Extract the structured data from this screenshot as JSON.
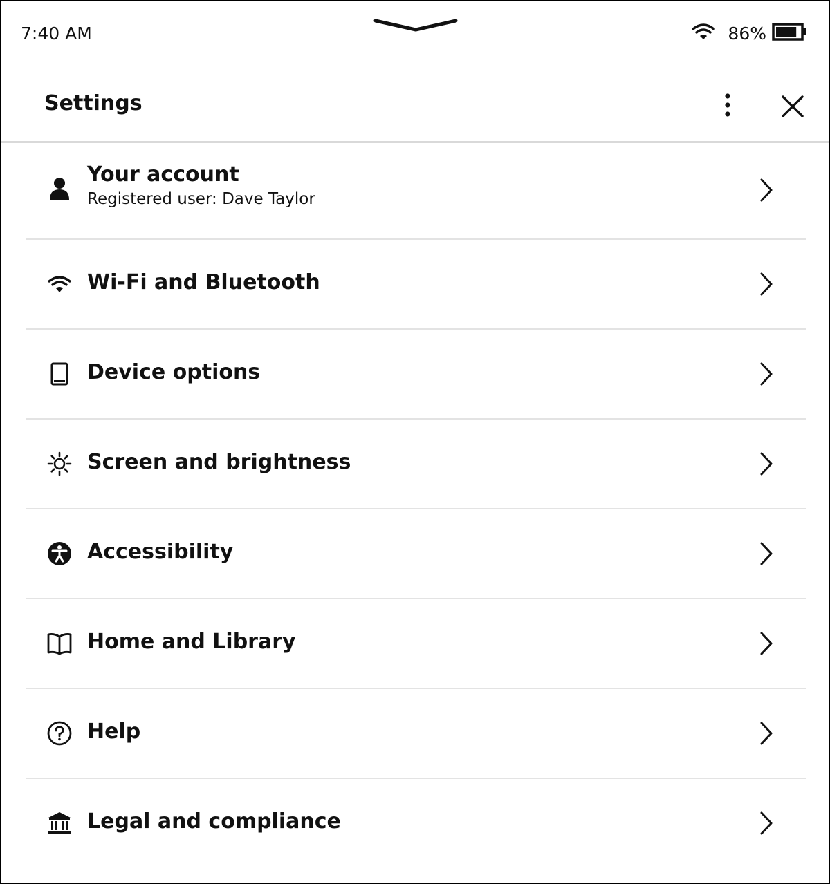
{
  "status_bar": {
    "time": "7:40 AM",
    "battery_percent": "86%",
    "battery_level": 0.86,
    "icons": [
      "pulldown-chevron-icon",
      "wifi-icon",
      "battery-icon"
    ]
  },
  "header": {
    "title": "Settings",
    "more_icon": "kebab-menu-icon",
    "close_icon": "close-icon"
  },
  "settings": {
    "items": [
      {
        "label": "Your account",
        "sublabel": "Registered user: Dave Taylor",
        "icon": "person-icon"
      },
      {
        "label": "Wi-Fi and Bluetooth",
        "icon": "wifi-icon"
      },
      {
        "label": "Device options",
        "icon": "tablet-icon"
      },
      {
        "label": "Screen and brightness",
        "icon": "brightness-icon"
      },
      {
        "label": "Accessibility",
        "icon": "accessibility-icon"
      },
      {
        "label": "Home and Library",
        "icon": "book-icon"
      },
      {
        "label": "Help",
        "icon": "help-icon"
      },
      {
        "label": "Legal and compliance",
        "icon": "bank-icon"
      }
    ]
  },
  "colors": {
    "text": "#111111",
    "divider": "#e3e3e3",
    "header_rule": "#d9d9d9",
    "background": "#ffffff"
  }
}
